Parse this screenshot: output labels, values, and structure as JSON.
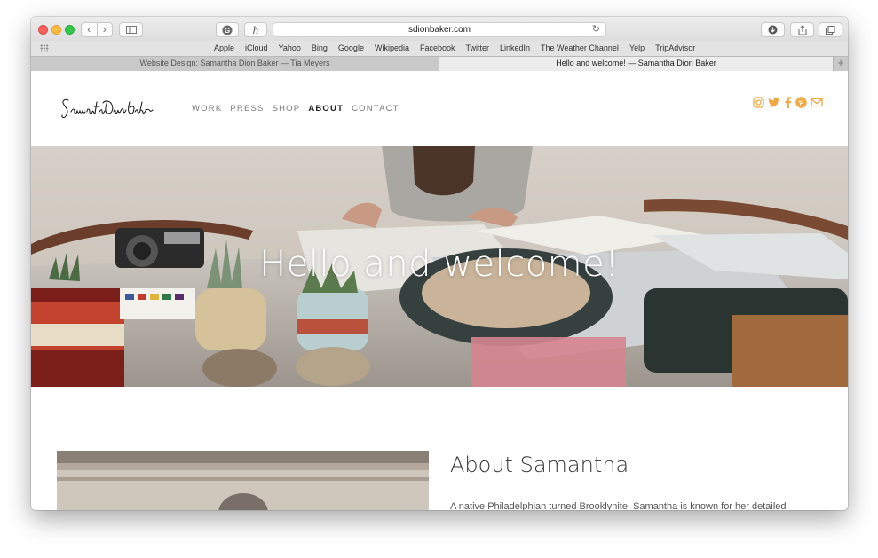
{
  "browser": {
    "url": "sdionbaker.com",
    "favorites": [
      "Apple",
      "iCloud",
      "Yahoo",
      "Bing",
      "Google",
      "Wikipedia",
      "Facebook",
      "Twitter",
      "LinkedIn",
      "The Weather Channel",
      "Yelp",
      "TripAdvisor"
    ],
    "tabs": [
      {
        "title": "Website Design: Samantha Dion Baker — Tia Meyers",
        "active": false
      },
      {
        "title": "Hello and welcome! — Samantha Dion Baker",
        "active": true
      }
    ],
    "new_tab": "+"
  },
  "site": {
    "logo_text": "Samantha Dion Baker",
    "nav": [
      {
        "label": "WORK",
        "active": false
      },
      {
        "label": "PRESS",
        "active": false
      },
      {
        "label": "SHOP",
        "active": false
      },
      {
        "label": "ABOUT",
        "active": true
      },
      {
        "label": "CONTACT",
        "active": false
      }
    ],
    "social_icons": [
      "instagram-icon",
      "twitter-icon",
      "facebook-icon",
      "pinterest-icon",
      "email-icon"
    ],
    "accent_color": "#f0a844"
  },
  "hero": {
    "title": "Hello and welcome!"
  },
  "about": {
    "title": "About Samantha",
    "text": "A native Philadelphian turned Brooklynite, Samantha is known for her detailed"
  }
}
